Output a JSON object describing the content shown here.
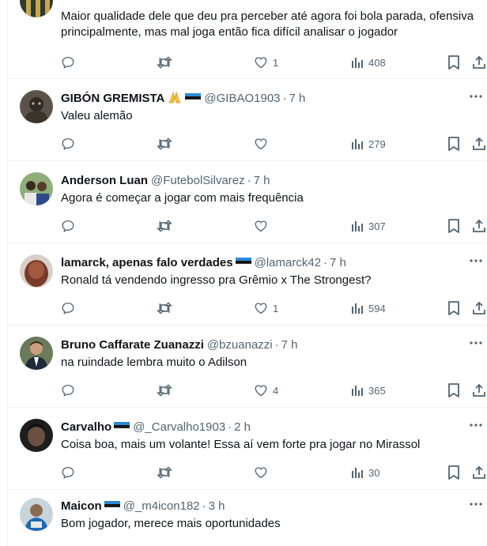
{
  "tweets": [
    {
      "name": "",
      "handle": "",
      "time": "",
      "text": "Maior qualidade dele que deu pra perceber até agora foi bola parada, ofensiva principalmente, mas mal joga então fica difícil analisar o jogador",
      "likes": "1",
      "views": "408",
      "avatar_color": "#3a3a3a"
    },
    {
      "name": "GIBÓN GREMISTA",
      "handle": "@GIBAO1903",
      "time": "7 h",
      "text": "Valeu alemão",
      "likes": "",
      "views": "279",
      "avatar_color": "#4a4540"
    },
    {
      "name": "Anderson Luan",
      "handle": "@FutebolSilvarez",
      "time": "7 h",
      "text": "Agora é começar a jogar com mais frequência",
      "likes": "",
      "views": "307",
      "avatar_color": "#6b8a5a"
    },
    {
      "name": "lamarck, apenas falo verdades",
      "handle": "@lamarck42",
      "time": "7 h",
      "text": "Ronald tá vendendo ingresso pra Grêmio x The Strongest?",
      "likes": "1",
      "views": "594",
      "avatar_color": "#7a4a3a"
    },
    {
      "name": "Bruno Caffarate Zuanazzi",
      "handle": "@bzuanazzi",
      "time": "7 h",
      "text": "na ruindade lembra muito o Adilson",
      "likes": "4",
      "views": "365",
      "avatar_color": "#3a4a3a"
    },
    {
      "name": "Carvalho",
      "handle": "@_Carvalho1903",
      "time": "2 h",
      "text": "Coisa boa, mais um volante! Essa aí vem forte pra jogar no Mirassol",
      "likes": "",
      "views": "30",
      "avatar_color": "#2a2a2a"
    },
    {
      "name": "Maicon",
      "handle": "@_m4icon182",
      "time": "3 h",
      "text": "Bom jogador, merece mais oportunidades",
      "likes": "",
      "views": "",
      "avatar_color": "#4a5a6a"
    }
  ]
}
